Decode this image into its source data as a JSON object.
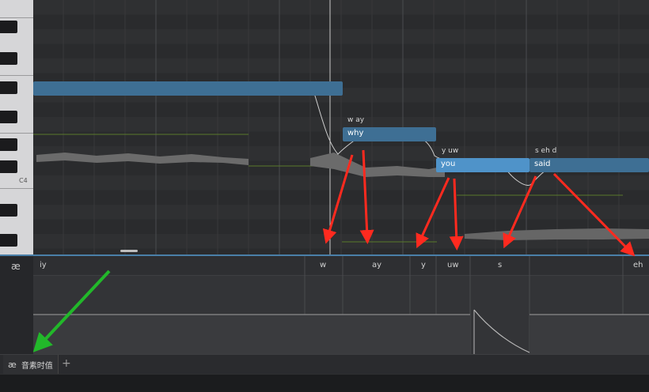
{
  "piano": {
    "octave_label": "C4"
  },
  "notes": [
    {
      "lyric": "",
      "phonemes": "",
      "selected": false
    },
    {
      "lyric": "why",
      "phonemes": "w ay",
      "selected": false
    },
    {
      "lyric": "you",
      "phonemes": "y uw",
      "selected": true
    },
    {
      "lyric": "said",
      "phonemes": "s eh d",
      "selected": false
    }
  ],
  "phoneme_lane": {
    "symbol": "æ",
    "phonemes": [
      "iy",
      "w",
      "ay",
      "y",
      "uw",
      "s",
      "eh"
    ]
  },
  "tabs": [
    {
      "symbol": "æ",
      "label": "音素时值"
    }
  ],
  "add_tab_label": "+",
  "colors": {
    "note": "#3e6f94",
    "note_selected": "#4f93c9",
    "annotation_red": "#ff2a1f",
    "annotation_green": "#22b82a"
  }
}
